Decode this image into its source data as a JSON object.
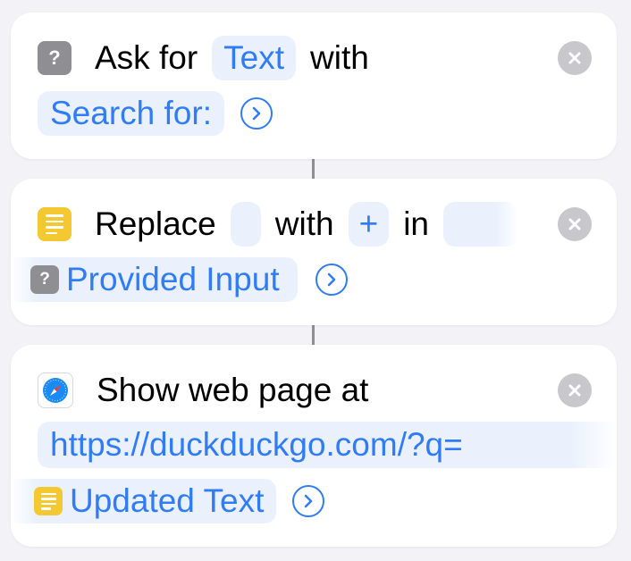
{
  "actions": [
    {
      "icon": "ask-for-input-icon",
      "label_prefix": "Ask for",
      "type_token": "Text",
      "label_with": "with",
      "prompt_token": "Search for:",
      "icon_glyph": "?"
    },
    {
      "icon": "text-replace-icon",
      "label_prefix": "Replace",
      "label_with": "with",
      "replace_token": "+",
      "label_in": "in",
      "variable_token": "Provided Input",
      "variable_icon_glyph": "?"
    },
    {
      "icon": "safari-icon",
      "label": "Show web page at",
      "url_token": "https://duckduckgo.com/?q=",
      "variable_token": "Updated Text"
    }
  ],
  "colors": {
    "accent": "#2f7cf6",
    "token_bg": "#eaf1fc",
    "card_bg": "#ffffff",
    "page_bg": "#f2f2f7",
    "close_bg": "#c7c7cc"
  }
}
